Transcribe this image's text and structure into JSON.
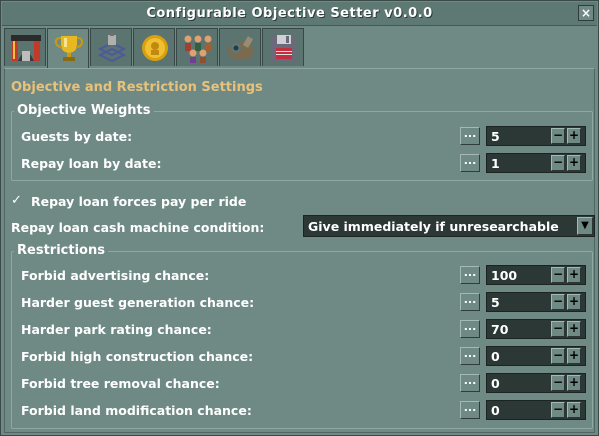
{
  "window": {
    "title": "Configurable Objective Setter v0.0.0",
    "close_label": "×"
  },
  "tabs": [
    {
      "name": "park-entrance-icon"
    },
    {
      "name": "trophy-icon"
    },
    {
      "name": "research-icon"
    },
    {
      "name": "coin-icon"
    },
    {
      "name": "guests-icon"
    },
    {
      "name": "scenery-icon"
    },
    {
      "name": "save-disk-icon"
    }
  ],
  "heading": "Objective and Restriction Settings",
  "objective_weights": {
    "title": "Objective Weights",
    "rows": [
      {
        "label": "Guests by date:",
        "value": "5"
      },
      {
        "label": "Repay loan by date:",
        "value": "1"
      }
    ]
  },
  "repay_checkbox": {
    "mark": "✓",
    "label": "Repay loan forces pay per ride"
  },
  "cash_machine": {
    "label": "Repay loan cash machine condition:",
    "value": "Give immediately if unresearchable",
    "arrow": "▼"
  },
  "restrictions": {
    "title": "Restrictions",
    "rows": [
      {
        "label": "Forbid advertising chance:",
        "value": "100"
      },
      {
        "label": "Harder guest generation chance:",
        "value": "5"
      },
      {
        "label": "Harder park rating chance:",
        "value": "70"
      },
      {
        "label": "Forbid high construction chance:",
        "value": "0"
      },
      {
        "label": "Forbid tree removal chance:",
        "value": "0"
      },
      {
        "label": "Forbid land modification chance:",
        "value": "0"
      }
    ]
  },
  "controls": {
    "dots": "...",
    "minus": "−",
    "plus": "+"
  }
}
